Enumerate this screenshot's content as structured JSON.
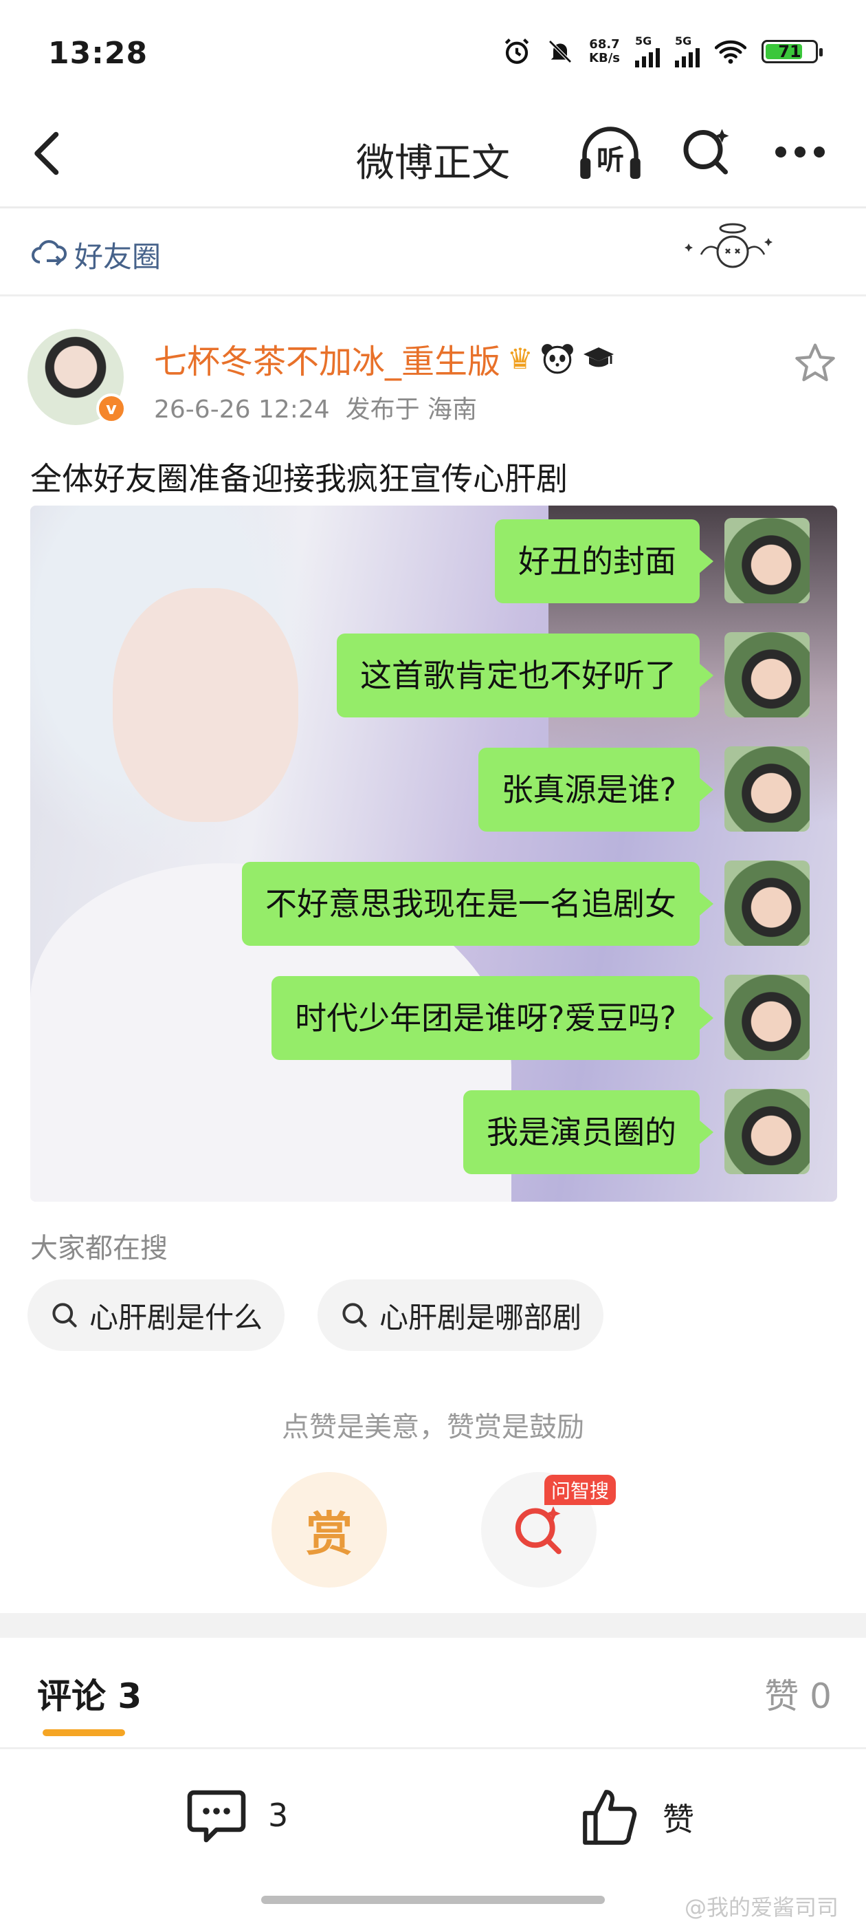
{
  "status_bar": {
    "time": "13:28",
    "net_speed_value": "68.7",
    "net_speed_unit": "KB/s",
    "sim1_label": "5G",
    "sim2_label": "5G",
    "battery": "71"
  },
  "nav": {
    "title": "微博正文",
    "listen_label": "听"
  },
  "friends_circle": {
    "label": "好友圈"
  },
  "post": {
    "username": "七杯冬茶不加冰_重生版",
    "verified_mark": "v",
    "meta": "26-6-26 12:24  发布于 海南",
    "text": "全体好友圈准备迎接我疯狂宣传心肝剧",
    "chat_messages": [
      "好丑的封面",
      "这首歌肯定也不好听了",
      "张真源是谁?",
      "不好意思我现在是一名追剧女",
      "时代少年团是谁呀?爱豆吗?",
      "我是演员圈的"
    ]
  },
  "search": {
    "title": "大家都在搜",
    "chips": [
      "心肝剧是什么",
      "心肝剧是哪部剧"
    ]
  },
  "reward": {
    "text": "点赞是美意，赞赏是鼓励",
    "reward_label": "赏",
    "ask_badge": "问智搜"
  },
  "tabs": {
    "comments": "评论 3",
    "likes": "赞 0"
  },
  "bottom_bar": {
    "comment_count": "3",
    "like_label": "赞"
  },
  "watermark": "@我的爱酱司司",
  "colors": {
    "username": "#e8712a",
    "bubble": "#95ec69",
    "tab_underline": "#f5a524",
    "link_blue": "#46628a"
  }
}
